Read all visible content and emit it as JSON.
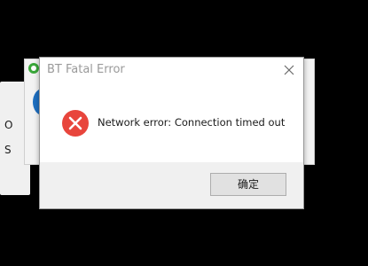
{
  "background_window": {
    "letters": [
      "O",
      "S"
    ]
  },
  "dialog": {
    "title": "BT Fatal Error",
    "close_icon": "close-icon",
    "error_icon": "error-icon",
    "message": "Network error: Connection timed out",
    "ok_label": "确定"
  },
  "colors": {
    "error_red": "#e8453c",
    "title_text": "#9a9a9a",
    "footer_bg": "#f0f0f0",
    "button_bg": "#e1e1e1"
  }
}
